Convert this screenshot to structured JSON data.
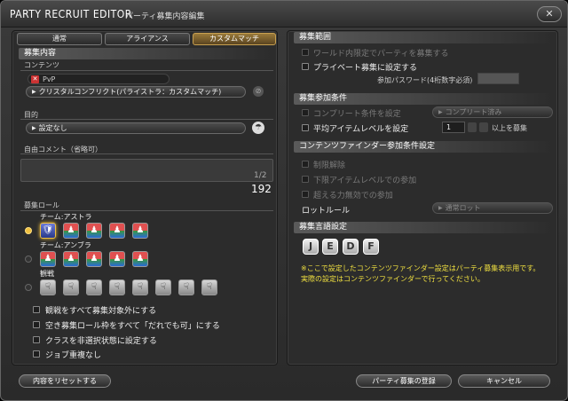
{
  "window": {
    "title": "PARTY RECRUIT EDITOR",
    "subtitle": "パーティ募集内容編集",
    "close_icon": "close-icon"
  },
  "tabs": [
    "通常",
    "アライアンス",
    "カスタムマッチ"
  ],
  "left": {
    "section_title": "募集内容",
    "content_label": "コンテンツ",
    "content_tag": "PvP",
    "content_value": "クリスタルコンフリクト(パライストラ：カスタムマッチ)",
    "purpose_label": "目的",
    "purpose_value": "設定なし",
    "comment_label": "自由コメント（省略可）",
    "comment_pages": "1/2",
    "comment_count": "192",
    "roles_label": "募集ロール",
    "team1": "チーム:アストラ",
    "team2": "チーム:アンブラ",
    "spectator": "観戦",
    "opt1": "観戦をすべて募集対象外にする",
    "opt2": "空き募集ロール枠をすべて「だれでも可」にする",
    "opt3": "クラスを非選択状態に設定する",
    "opt4": "ジョブ重複なし"
  },
  "right": {
    "range_title": "募集範囲",
    "range_opt1": "ワールド内限定でパーティを募集する",
    "range_opt2": "プライベート募集に設定する",
    "password_label": "参加パスワード(4桁数字必須)",
    "cond_title": "募集参加条件",
    "complete_label": "コンプリート条件を設定",
    "complete_value": "コンプリート済み",
    "avg_label": "平均アイテムレベルを設定",
    "avg_value": "1",
    "avg_suffix": "以上を募集",
    "cf_title": "コンテンツファインダー参加条件設定",
    "cf_opt1": "制限解除",
    "cf_opt2": "下限アイテムレベルでの参加",
    "cf_opt3": "超える力無効での参加",
    "loot_label": "ロットルール",
    "loot_value": "通常ロット",
    "lang_title": "募集言語設定",
    "langs": [
      "J",
      "E",
      "D",
      "F"
    ],
    "note1": "※ここで設定したコンテンツファインダー設定はパーティ募集表示用です。",
    "note2": "実際の設定はコンテンツファインダーで行ってください。"
  },
  "footer": {
    "reset": "内容をリセットする",
    "register": "パーティ募集の登録",
    "cancel": "キャンセル"
  }
}
